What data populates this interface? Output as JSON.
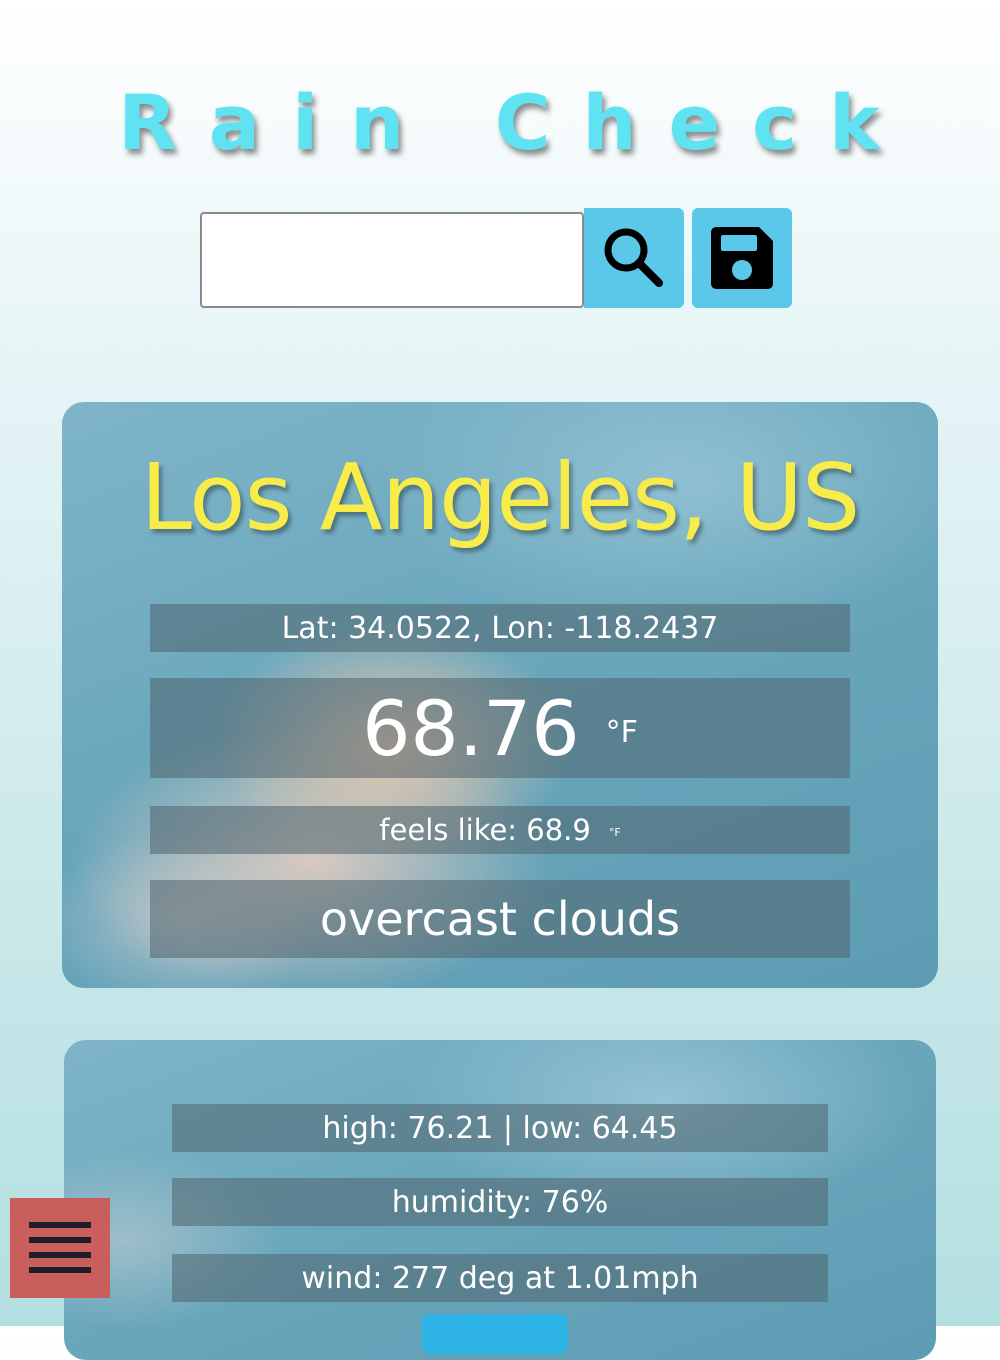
{
  "header": {
    "title": "Rain Check"
  },
  "search": {
    "value": "",
    "placeholder": ""
  },
  "toolbar": {
    "search_icon": "search-icon",
    "save_icon": "floppy-disk-icon"
  },
  "current": {
    "city": "Los Angeles, US",
    "coords": "Lat: 34.0522, Lon: -118.2437",
    "temp": "68.76",
    "temp_unit": "°F",
    "feels_like_label": "feels like: 68.9",
    "feels_unit": "°F",
    "description": "overcast clouds"
  },
  "details": {
    "high_low": "high: 76.21 | low: 64.45",
    "humidity": "humidity: 76%",
    "wind": "wind: 277 deg at 1.01mph"
  },
  "menu": {
    "icon": "hamburger-menu-icon"
  },
  "colors": {
    "title": "#5fe3f2",
    "button": "#5bc8ea",
    "city": "#f7ec4a",
    "menu_button": "#c95f5c"
  }
}
